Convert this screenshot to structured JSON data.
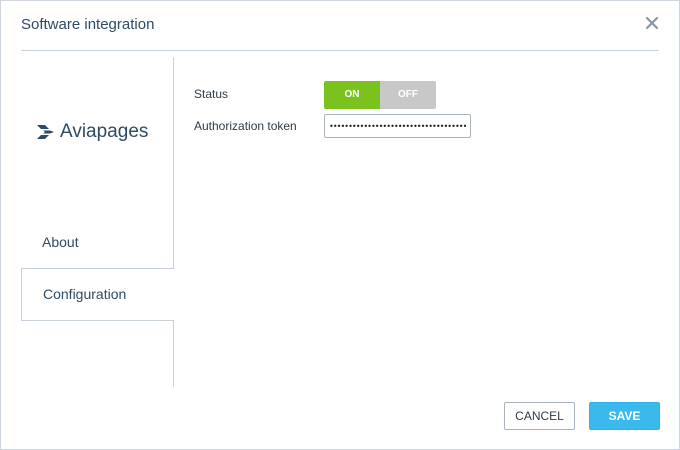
{
  "dialog": {
    "title": "Software integration",
    "close_icon": "close-icon"
  },
  "sidebar": {
    "logo": {
      "text": "Aviapages",
      "icon": "aviapages-logo-mark"
    },
    "items": [
      {
        "label": "About",
        "active": false
      },
      {
        "label": "Configuration",
        "active": true
      }
    ]
  },
  "form": {
    "status": {
      "label": "Status",
      "on_label": "ON",
      "off_label": "OFF",
      "value": "ON"
    },
    "token": {
      "label": "Authorization token",
      "value": "••••••••••••••••••••••••••••••••••••••••••"
    }
  },
  "footer": {
    "cancel_label": "CANCEL",
    "save_label": "SAVE"
  },
  "colors": {
    "title_text": "#2f4a63",
    "toggle_on": "#7cc21f",
    "toggle_off": "#c8c8c8",
    "save_button": "#39b9ec",
    "border": "#c9d1da"
  }
}
